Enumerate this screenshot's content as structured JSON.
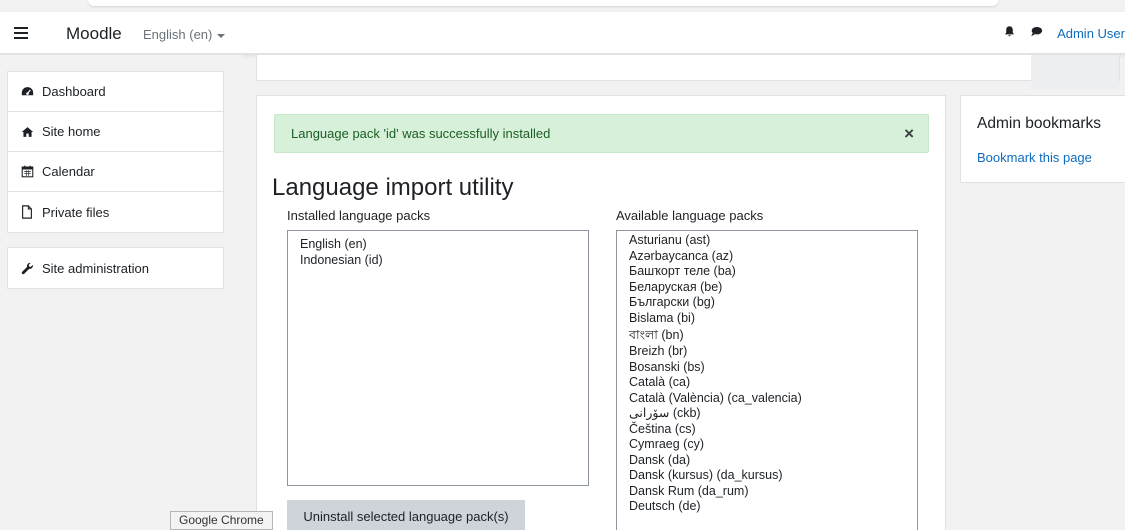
{
  "navbar": {
    "brand": "Moodle",
    "language": "English (en)",
    "user_name": "Admin User"
  },
  "drawer": {
    "items": [
      {
        "label": "Dashboard",
        "icon": "dashboard-icon"
      },
      {
        "label": "Site home",
        "icon": "home-icon"
      },
      {
        "label": "Calendar",
        "icon": "calendar-icon"
      },
      {
        "label": "Private files",
        "icon": "file-icon"
      }
    ],
    "admin_item": {
      "label": "Site administration",
      "icon": "wrench-icon"
    }
  },
  "alert": {
    "message": "Language pack 'id' was successfully installed",
    "close_symbol": "×"
  },
  "page": {
    "title": "Language import utility",
    "installed_label": "Installed language packs",
    "available_label": "Available language packs",
    "installed_packs": [
      "English (en)",
      "Indonesian (id)"
    ],
    "available_packs": [
      "Asturianu (ast)",
      "Azərbaycanca (az)",
      "Башҡорт теле (ba)",
      "Беларуская (be)",
      "Български (bg)",
      "Bislama (bi)",
      "বাংলা (bn)",
      "Breizh (br)",
      "Bosanski (bs)",
      "Català (ca)",
      "Català (València) (ca_valencia)",
      "سۆرانی (ckb)",
      "Čeština (cs)",
      "Cymraeg (cy)",
      "Dansk (da)",
      "Dansk (kursus) (da_kursus)",
      "Dansk Rum (da_rum)",
      "Deutsch (de)"
    ],
    "uninstall_button": "Uninstall selected language pack(s)"
  },
  "admin_bookmarks": {
    "title": "Admin bookmarks",
    "link": "Bookmark this page"
  },
  "tooltip": "Google Chrome",
  "colors": {
    "link": "#0f6cbf",
    "success_bg": "#d7f0d9",
    "success_text": "#1c5e25",
    "button_bg": "#ced4da"
  }
}
